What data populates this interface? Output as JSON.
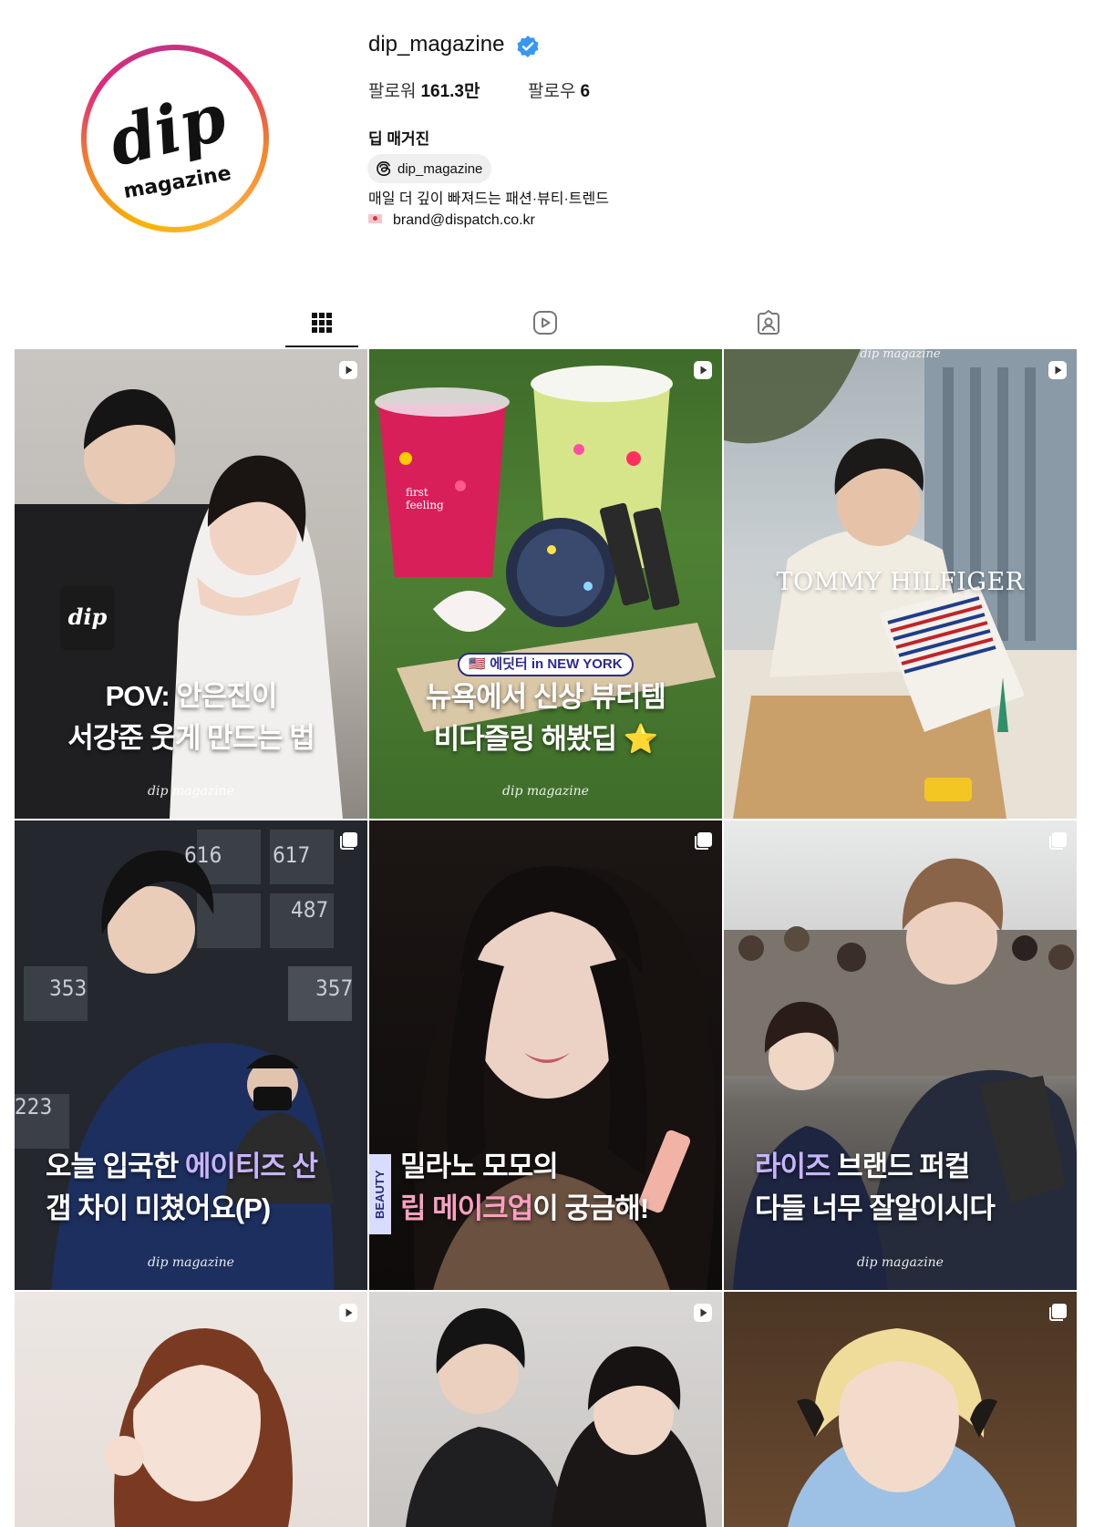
{
  "profile": {
    "username": "dip_magazine",
    "verified": true,
    "followers_label": "팔로워",
    "followers_value": "161.3만",
    "following_label": "팔로우",
    "following_value": "6",
    "full_name": "딥 매거진",
    "threads_handle": "dip_magazine",
    "bio_line1": "매일 더 깊이 빠져드는 패션·뷰티·트렌드",
    "bio_email": "brand@dispatch.co.kr",
    "avatar_logo_top": "dip",
    "avatar_logo_bottom": "magazine"
  },
  "tabs": [
    {
      "icon": "grid-icon",
      "active": true
    },
    {
      "icon": "reels-icon",
      "active": false
    },
    {
      "icon": "tagged-icon",
      "active": false
    }
  ],
  "posts": [
    {
      "type": "reel",
      "line1_a": "POV: ",
      "line1_b": "안은진이",
      "line2": "서강준 웃게 만드는 법",
      "watermark": "dip magazine",
      "hand_logo": "dip"
    },
    {
      "type": "reel",
      "pill": "🇺🇸 에딧터 in NEW YORK",
      "line1": "뉴욕에서 신상 뷰티템",
      "line2": "비다즐링 해봤딥 ⭐",
      "watermark": "dip magazine",
      "cup_text": "first feeling"
    },
    {
      "type": "reel",
      "brand": "TOMMY HILFIGER",
      "top_mark": "dip magazine"
    },
    {
      "type": "carousel",
      "line1_a": "오늘 입국한 ",
      "line1_hl": "에이티즈 산",
      "line2": "갭 차이 미쳤어요(P)",
      "watermark": "dip magazine",
      "boxes": [
        "616",
        "617",
        "487",
        "357",
        "353",
        "223"
      ]
    },
    {
      "type": "carousel",
      "tag": "BEAUTY",
      "line1": "밀라노 모모의",
      "line2_hl": "립 메이크업",
      "line2_b": "이 궁금해!"
    },
    {
      "type": "carousel",
      "line1_hl": "라이즈",
      "line1_b": " 브랜드 퍼컬",
      "line2": "다들 너무 잘알이시다",
      "watermark": "dip magazine"
    },
    {
      "type": "reel"
    },
    {
      "type": "reel"
    },
    {
      "type": "carousel"
    }
  ],
  "colors": {
    "verified_blue": "#3897f0",
    "text": "#111111",
    "chip_bg": "#efefef"
  }
}
